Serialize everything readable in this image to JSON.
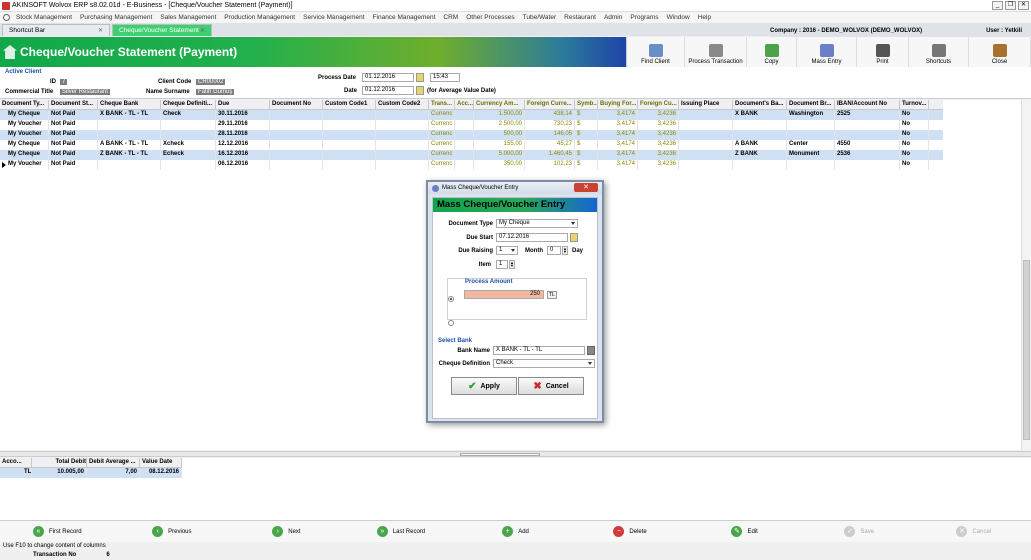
{
  "window": {
    "title": "AKINSOFT Wolvox ERP s8.02.01d - E-Business - [Cheque/Voucher Statement (Payment)]"
  },
  "menu": [
    "Stock Management",
    "Purchasing Management",
    "Sales Management",
    "Production Management",
    "Service Management",
    "Finance Management",
    "CRM",
    "Other Processes",
    "Tube/Water",
    "Restaurant",
    "Admin",
    "Programs",
    "Window",
    "Help"
  ],
  "tabs": [
    {
      "label": "Shortcut Bar"
    },
    {
      "label": "Cheque/Voucher Statement"
    }
  ],
  "company": {
    "text": "Company : 2016 - DEMO_WOLVOX (DEMO_WOLVOX)",
    "user": "User : Yetkili"
  },
  "header": {
    "title": "Cheque/Voucher Statement (Payment)"
  },
  "toolbar": [
    "Find Client",
    "Process Transaction",
    "Copy",
    "Mass Entry",
    "Print",
    "Shortcuts",
    "Close"
  ],
  "info": {
    "active_client": "Active Client",
    "id_label": "ID",
    "id_value": "7",
    "client_code_label": "Client Code",
    "client_code_value": "CR00002",
    "commercial_title_label": "Commercial Title",
    "commercial_title_value": "Silver Restaurant",
    "name_surname_label": "Name Surname",
    "name_surname_value": "Fatih Gümüş",
    "process_date_label": "Process Date",
    "process_date_value": "01.12.2016",
    "process_time": "15:43",
    "date_label": "Date",
    "date_value": "01.12.2016",
    "date_note": "(for Average Value Date)"
  },
  "grid": {
    "headers": [
      "Document Ty...",
      "Document St...",
      "Cheque Bank",
      "Cheque Definiti...",
      "Due",
      "Document No",
      "Custom Code1",
      "Custom Code2",
      "Trans...",
      "Acc...",
      "Currency Am...",
      "Foreign Curre...",
      "Symb...",
      "Buying For...",
      "Foreign Cu...",
      "Issuing Place",
      "Document's Ba...",
      "Document Br...",
      "IBAN/Account No",
      "Turnov..."
    ],
    "rows": [
      [
        "My Cheque",
        "Not Paid",
        "X BANK - TL - TL",
        "Check",
        "30.11.2016",
        "",
        "",
        "",
        "Currenc OC",
        "",
        "1.500,00",
        "438,14",
        "$",
        "3,4174",
        "3,4236",
        "",
        "X BANK",
        "Washington",
        "2525",
        "No"
      ],
      [
        "My Voucher",
        "Not Paid",
        "",
        "",
        "29.11.2016",
        "",
        "",
        "",
        "Currenc OC",
        "",
        "2.500,00",
        "730,23",
        "$",
        "3,4174",
        "3,4236",
        "",
        "",
        "",
        "",
        "No"
      ],
      [
        "My Voucher",
        "Not Paid",
        "",
        "",
        "28.11.2016",
        "",
        "",
        "",
        "Currenc OC",
        "",
        "500,00",
        "146,05",
        "$",
        "3,4174",
        "3,4236",
        "",
        "",
        "",
        "",
        "No"
      ],
      [
        "My Cheque",
        "Not Paid",
        "A BANK - TL - TL",
        "Xcheck",
        "12.12.2016",
        "",
        "",
        "",
        "Currenc OC",
        "",
        "155,00",
        "45,27",
        "$",
        "3,4174",
        "3,4236",
        "",
        "A BANK",
        "Center",
        "4550",
        "No"
      ],
      [
        "My Cheque",
        "Not Paid",
        "Z BANK - TL - TL",
        "Echeck",
        "16.12.2016",
        "",
        "",
        "",
        "Currenc OC",
        "",
        "5.000,00",
        "1.460,45",
        "$",
        "3,4174",
        "3,4236",
        "",
        "Z BANK",
        "Monument",
        "2536",
        "No"
      ],
      [
        "My Voucher",
        "Not Paid",
        "",
        "",
        "06.12.2016",
        "",
        "",
        "",
        "Currenc OC",
        "",
        "350,00",
        "102,23",
        "$",
        "3,4174",
        "3,4236",
        "",
        "",
        "",
        "",
        "No"
      ]
    ]
  },
  "summary": {
    "headers": [
      "Acco...",
      "Total Debit",
      "Debit Average ...",
      "Value Date"
    ],
    "row": [
      "TL",
      "10.005,00",
      "7,00",
      "08.12.2016"
    ]
  },
  "nav": [
    "First Record",
    "Previous",
    "Next",
    "Last Record",
    "Add",
    "Delete",
    "Edit",
    "Save",
    "Cancel"
  ],
  "status": {
    "hint": "Use F10 to change content of columns",
    "tx_label": "Transaction No",
    "tx_value": "6"
  },
  "dialog": {
    "title": "Mass Cheque/Voucher Entry",
    "heading": "Mass Cheque/Voucher Entry",
    "doc_type_label": "Document Type",
    "doc_type_value": "My Cheque",
    "due_start_label": "Due Start",
    "due_start_value": "07.12.2016",
    "due_raising_label": "Due Raising",
    "due_raising_value": "1",
    "month_label": "Month",
    "month_value": "0",
    "day_label": "Day",
    "item_label": "Item",
    "item_value": "1",
    "process_amount_label": "Process Amount",
    "process_amount_value": "250",
    "currency": "TL",
    "select_bank": "Select Bank",
    "bank_name_label": "Bank Name",
    "bank_name_value": "X BANK - TL - TL",
    "cheque_def_label": "Cheque Definition",
    "cheque_def_value": "Check",
    "apply": "Apply",
    "cancel": "Cancel"
  }
}
